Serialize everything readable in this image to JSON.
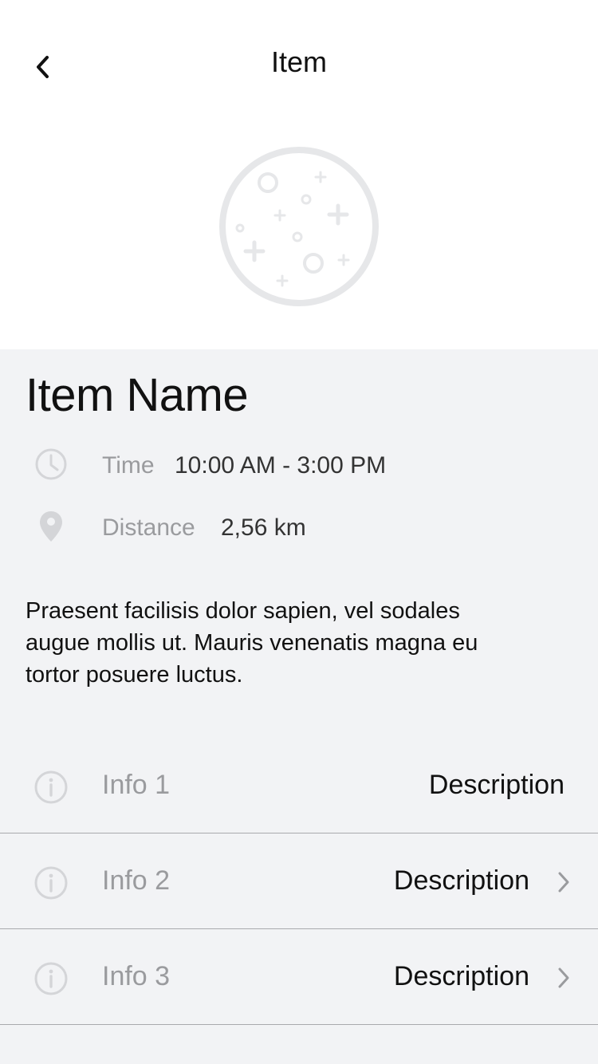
{
  "nav": {
    "title": "Item",
    "back_icon": "chevron-left-icon"
  },
  "hero": {
    "icon": "moon-placeholder-icon"
  },
  "item": {
    "name": "Item Name",
    "time_label": "Time",
    "time_value": "10:00 AM - 3:00 PM",
    "distance_label": "Distance",
    "distance_value": "2,56 km",
    "description": "Praesent facilisis dolor sapien, vel sodales augue mollis ut. Mauris venenatis magna eu tortor posuere luctus."
  },
  "info_rows": [
    {
      "label": "Info 1",
      "value": "Description",
      "icon": "info-icon",
      "has_chevron": false
    },
    {
      "label": "Info 2",
      "value": "Description",
      "icon": "info-icon",
      "has_chevron": true
    },
    {
      "label": "Info 3",
      "value": "Description",
      "icon": "info-icon",
      "has_chevron": true
    }
  ],
  "colors": {
    "background": "#f2f3f5",
    "header_background": "#ffffff",
    "secondary_text": "#9a9b9e",
    "icon_gray": "#d4d5d8",
    "divider": "#a9aaad"
  }
}
